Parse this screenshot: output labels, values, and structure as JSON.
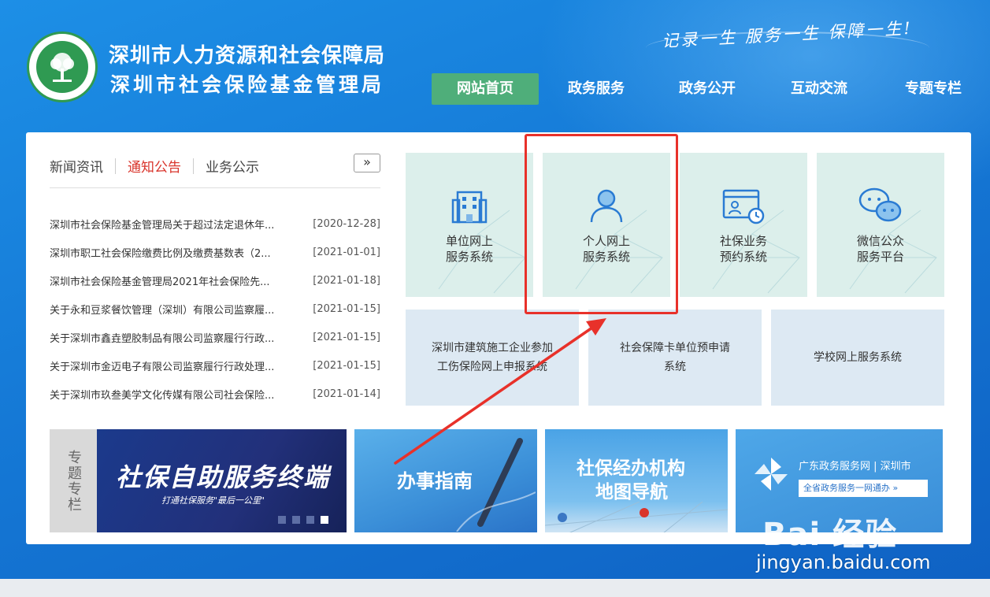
{
  "header": {
    "org_name_1": "深圳市人力资源和社会保障局",
    "org_name_2": "深圳市社会保险基金管理局",
    "slogan": "记录一生 服务一生 保障一生!"
  },
  "nav": {
    "items": [
      {
        "label": "网站首页",
        "active": true
      },
      {
        "label": "政务服务"
      },
      {
        "label": "政务公开"
      },
      {
        "label": "互动交流"
      },
      {
        "label": "专题专栏"
      }
    ]
  },
  "news": {
    "tabs": [
      "新闻资讯",
      "通知公告",
      "业务公示"
    ],
    "active_tab": "通知公告",
    "more_label": "»",
    "items": [
      {
        "title": "深圳市社会保险基金管理局关于超过法定退休年...",
        "date": "[2020-12-28]"
      },
      {
        "title": "深圳市职工社会保险缴费比例及缴费基数表（2...",
        "date": "[2021-01-01]"
      },
      {
        "title": "深圳市社会保险基金管理局2021年社会保险先...",
        "date": "[2021-01-18]"
      },
      {
        "title": "关于永和豆浆餐饮管理（深圳）有限公司监察履...",
        "date": "[2021-01-15]"
      },
      {
        "title": "关于深圳市鑫垚塑胶制品有限公司监察履行行政...",
        "date": "[2021-01-15]"
      },
      {
        "title": "关于深圳市金迈电子有限公司监察履行行政处理...",
        "date": "[2021-01-15]"
      },
      {
        "title": "关于深圳市玖叁美学文化传媒有限公司社会保险...",
        "date": "[2021-01-14]"
      }
    ]
  },
  "services": {
    "top": [
      {
        "line1": "单位网上",
        "line2": "服务系统",
        "icon": "building-icon"
      },
      {
        "line1": "个人网上",
        "line2": "服务系统",
        "icon": "person-icon"
      },
      {
        "line1": "社保业务",
        "line2": "预约系统",
        "icon": "appointment-icon"
      },
      {
        "line1": "微信公众",
        "line2": "服务平台",
        "icon": "wechat-icon"
      }
    ],
    "bottom": [
      {
        "line1": "深圳市建筑施工企业参加",
        "line2": "工伤保险网上申报系统"
      },
      {
        "line1": "社会保障卡单位预申请",
        "line2": "系统"
      },
      {
        "line1": "学校网上服务系统",
        "line2": ""
      }
    ]
  },
  "banners": {
    "special_tag": "专题专栏",
    "special_title": "社保自助服务终端",
    "special_sub": "打通社保服务\"最后一公里\"",
    "guide_title": "办事指南",
    "map_title_1": "社保经办机构",
    "map_title_2": "地图导航",
    "gd_title": "广东政务服务网 | 深圳市",
    "gd_sub": "全省政务服务一网通办 »"
  },
  "watermark": {
    "logo": "Bai 经验",
    "url": "jingyan.baidu.com"
  },
  "colors": {
    "primary_blue": "#1579d6",
    "nav_active": "#4fae7a",
    "tab_active": "#d9342b",
    "annotation_red": "#e8312a"
  }
}
